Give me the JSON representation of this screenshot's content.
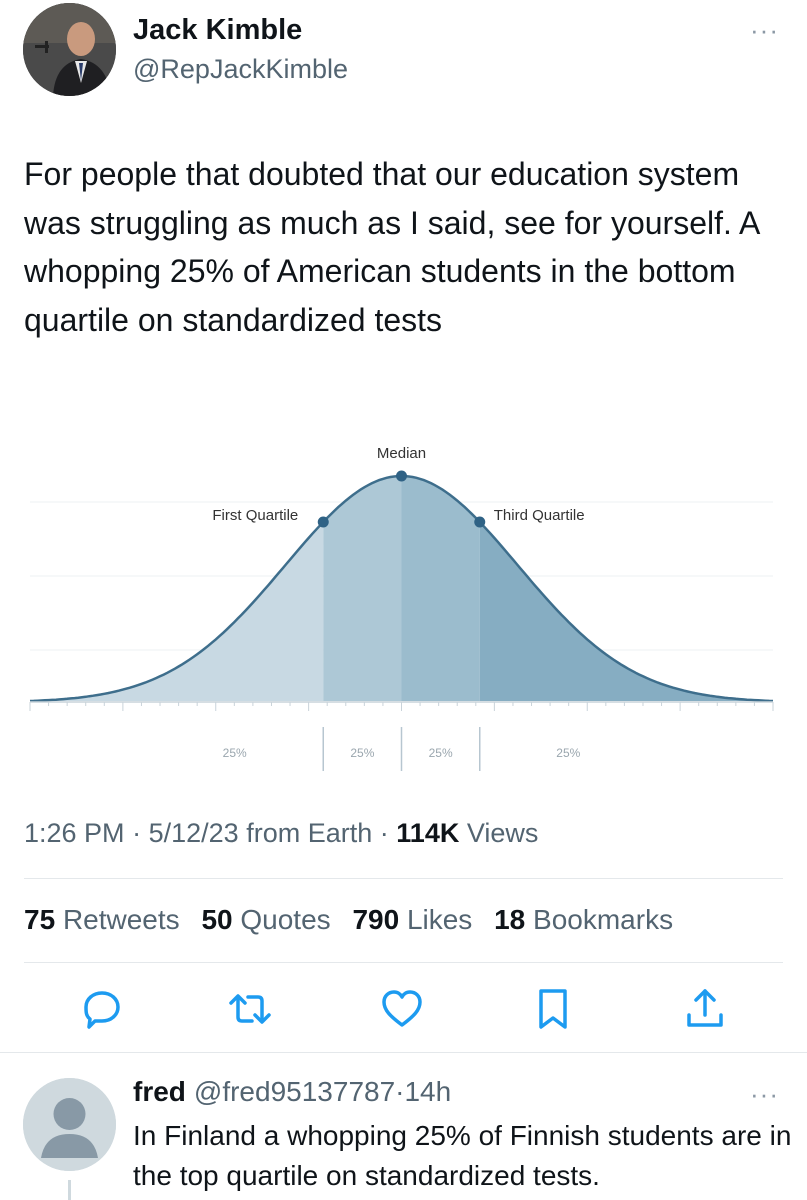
{
  "tweet": {
    "author_name": "Jack Kimble",
    "author_handle": "@RepJackKimble",
    "text": "For people that doubted that our education system was struggling as much as I said, see for yourself.  A whopping 25% of American students in the bottom quartile on standardized tests",
    "time": "1:26 PM",
    "date": "5/12/23",
    "source": "from Earth",
    "views_count": "114K",
    "views_label": "Views",
    "separator": "·"
  },
  "chart_data": {
    "type": "area",
    "title": "",
    "xlabel": "",
    "ylabel": "",
    "distribution": "normal",
    "x_range_sd": [
      -3.2,
      3.2
    ],
    "ylim": [
      0,
      1
    ],
    "markers": [
      {
        "label": "First Quartile",
        "x": -0.674
      },
      {
        "label": "Median",
        "x": 0
      },
      {
        "label": "Third Quartile",
        "x": 0.674
      }
    ],
    "segments": [
      {
        "label": "25%",
        "from": -3.2,
        "to": -0.674,
        "color": "#c8d9e3"
      },
      {
        "label": "25%",
        "from": -0.674,
        "to": 0,
        "color": "#adc8d6"
      },
      {
        "label": "25%",
        "from": 0,
        "to": 0.674,
        "color": "#9bbccd"
      },
      {
        "label": "25%",
        "from": 0.674,
        "to": 3.2,
        "color": "#86adc2"
      }
    ],
    "line_color": "#3e6e8c",
    "grid": true
  },
  "stats": {
    "retweets_count": "75",
    "retweets_label": "Retweets",
    "quotes_count": "50",
    "quotes_label": "Quotes",
    "likes_count": "790",
    "likes_label": "Likes",
    "bookmarks_count": "18",
    "bookmarks_label": "Bookmarks"
  },
  "actions": [
    "reply-icon",
    "retweet-icon",
    "like-icon",
    "bookmark-icon",
    "share-icon"
  ],
  "reply": {
    "author_name": "fred",
    "author_handle": "@fred95137787",
    "time": "14h",
    "text": "In Finland a whopping 25% of Finnish students are in the top quartile on standardized tests."
  },
  "colors": {
    "text": "#0f1419",
    "secondary": "#536471",
    "icon": "#1d9bf0"
  }
}
